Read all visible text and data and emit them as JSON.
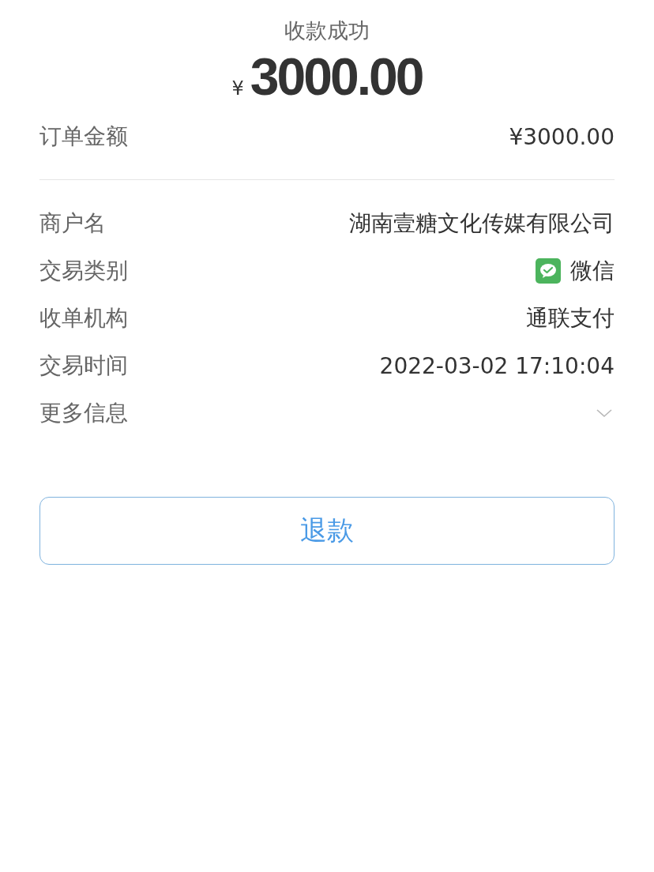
{
  "header": {
    "title": "收款成功",
    "currency": "¥",
    "amount": "3000.00"
  },
  "order_amount": {
    "label": "订单金额",
    "value": "¥3000.00"
  },
  "details": [
    {
      "kind": "text",
      "label": "商户名",
      "value": "湖南壹糖文化传媒有限公司"
    },
    {
      "kind": "payment",
      "label": "交易类别",
      "value": "微信"
    },
    {
      "kind": "text",
      "label": "收单机构",
      "value": "通联支付"
    },
    {
      "kind": "text",
      "label": "交易时间",
      "value": "2022-03-02 17:10:04"
    },
    {
      "kind": "expand",
      "label": "更多信息",
      "expanded": false
    }
  ],
  "refund_button": {
    "label": "退款"
  }
}
